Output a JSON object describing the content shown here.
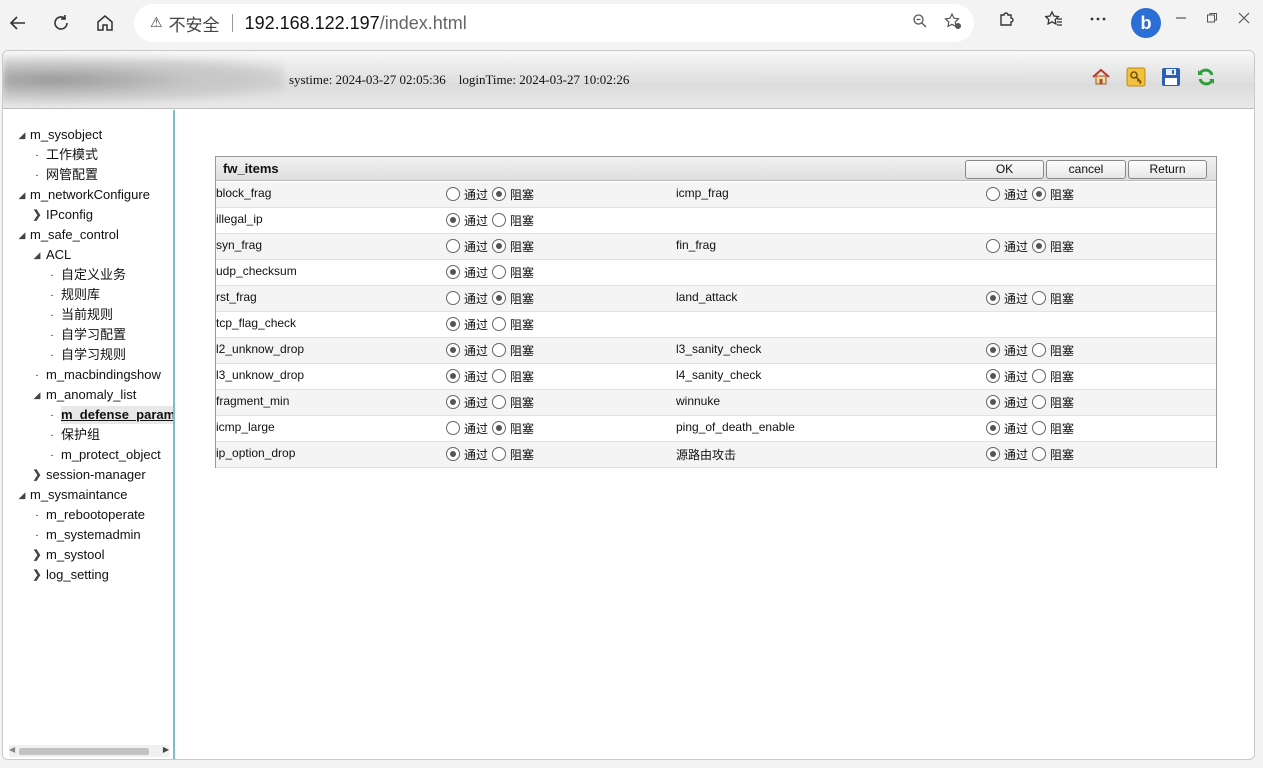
{
  "browser": {
    "security_label": "不安全",
    "url_host": "192.168.122.197",
    "url_path": "/index.html"
  },
  "header": {
    "systime": "systime: 2024-03-27 02:05:36",
    "logintime": "loginTime: 2024-03-27 10:02:26"
  },
  "sidebar": {
    "items": [
      {
        "label": "m_sysobject",
        "level": 0,
        "toggle": "open"
      },
      {
        "label": "工作模式",
        "level": 1,
        "toggle": "leaf"
      },
      {
        "label": "网管配置",
        "level": 1,
        "toggle": "leaf"
      },
      {
        "label": "m_networkConfigure",
        "level": 0,
        "toggle": "open"
      },
      {
        "label": "IPconfig",
        "level": 1,
        "toggle": "closed"
      },
      {
        "label": "m_safe_control",
        "level": 0,
        "toggle": "open"
      },
      {
        "label": "ACL",
        "level": 1,
        "toggle": "open"
      },
      {
        "label": "自定义业务",
        "level": 2,
        "toggle": "leaf"
      },
      {
        "label": "规则库",
        "level": 2,
        "toggle": "leaf"
      },
      {
        "label": "当前规则",
        "level": 2,
        "toggle": "leaf"
      },
      {
        "label": "自学习配置",
        "level": 2,
        "toggle": "leaf"
      },
      {
        "label": "自学习规则",
        "level": 2,
        "toggle": "leaf"
      },
      {
        "label": "m_macbindingshow",
        "level": 1,
        "toggle": "leaf"
      },
      {
        "label": "m_anomaly_list",
        "level": 1,
        "toggle": "open"
      },
      {
        "label": "m_defense_param",
        "level": 2,
        "toggle": "leaf",
        "selected": true
      },
      {
        "label": "保护组",
        "level": 2,
        "toggle": "leaf"
      },
      {
        "label": "m_protect_object",
        "level": 2,
        "toggle": "leaf"
      },
      {
        "label": "session-manager",
        "level": 1,
        "toggle": "closed"
      },
      {
        "label": "m_sysmaintance",
        "level": 0,
        "toggle": "open"
      },
      {
        "label": "m_rebootoperate",
        "level": 1,
        "toggle": "leaf"
      },
      {
        "label": "m_systemadmin",
        "level": 1,
        "toggle": "leaf"
      },
      {
        "label": "m_systool",
        "level": 1,
        "toggle": "closed"
      },
      {
        "label": "log_setting",
        "level": 1,
        "toggle": "closed"
      }
    ]
  },
  "panel": {
    "title": "fw_items",
    "ok_label": "OK",
    "cancel_label": "cancel",
    "return_label": "Return",
    "option_pass": "通过",
    "option_block": "阻塞",
    "rows": [
      [
        {
          "name": "block_frag",
          "value": "block"
        },
        {
          "name": "icmp_frag",
          "value": "block"
        }
      ],
      [
        {
          "name": "illegal_ip",
          "value": "pass"
        },
        null
      ],
      [
        {
          "name": "syn_frag",
          "value": "block"
        },
        {
          "name": "fin_frag",
          "value": "block"
        }
      ],
      [
        {
          "name": "udp_checksum",
          "value": "pass"
        },
        null
      ],
      [
        {
          "name": "rst_frag",
          "value": "block"
        },
        {
          "name": "land_attack",
          "value": "pass"
        }
      ],
      [
        {
          "name": "tcp_flag_check",
          "value": "pass"
        },
        null
      ],
      [
        {
          "name": "l2_unknow_drop",
          "value": "pass"
        },
        {
          "name": "l3_sanity_check",
          "value": "pass"
        }
      ],
      [
        {
          "name": "l3_unknow_drop",
          "value": "pass"
        },
        {
          "name": "l4_sanity_check",
          "value": "pass"
        }
      ],
      [
        {
          "name": "fragment_min",
          "value": "pass"
        },
        {
          "name": "winnuke",
          "value": "pass"
        }
      ],
      [
        {
          "name": "icmp_large",
          "value": "block"
        },
        {
          "name": "ping_of_death_enable",
          "value": "pass"
        }
      ],
      [
        {
          "name": "ip_option_drop",
          "value": "pass"
        },
        {
          "name": "源路由攻击",
          "value": "pass"
        }
      ]
    ]
  }
}
